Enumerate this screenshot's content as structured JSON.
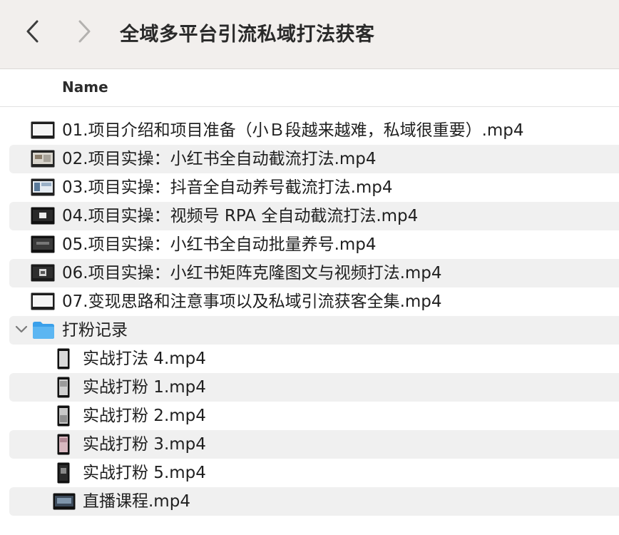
{
  "window": {
    "title": "全域多平台引流私域打法获客"
  },
  "columns": {
    "name": "Name"
  },
  "files": [
    {
      "name": "01.项目介绍和项目准备（小Ｂ段越来越难，私域很重要）.mp4",
      "icon": "video-thumbnail-icon"
    },
    {
      "name": "02.项目实操：小红书全自动截流打法.mp4",
      "icon": "video-thumbnail-icon"
    },
    {
      "name": "03.项目实操：抖音全自动养号截流打法.mp4",
      "icon": "video-thumbnail-icon"
    },
    {
      "name": "04.项目实操：视频号 RPA 全自动截流打法.mp4",
      "icon": "video-thumbnail-icon"
    },
    {
      "name": "05.项目实操：小红书全自动批量养号.mp4",
      "icon": "video-thumbnail-icon"
    },
    {
      "name": "06.项目实操：小红书矩阵克隆图文与视频打法.mp4",
      "icon": "video-thumbnail-icon"
    },
    {
      "name": "07.变现思路和注意事项以及私域引流获客全集.mp4",
      "icon": "video-thumbnail-icon"
    }
  ],
  "folder": {
    "name": "打粉记录",
    "icon": "folder-icon",
    "expanded": true,
    "children": [
      {
        "name": "实战打法 4.mp4",
        "icon": "video-thumbnail-icon"
      },
      {
        "name": "实战打粉 1.mp4",
        "icon": "video-thumbnail-icon"
      },
      {
        "name": "实战打粉 2.mp4",
        "icon": "video-thumbnail-icon"
      },
      {
        "name": "实战打粉 3.mp4",
        "icon": "video-thumbnail-icon"
      },
      {
        "name": "实战打粉 5.mp4",
        "icon": "video-thumbnail-icon"
      },
      {
        "name": "直播课程.mp4",
        "icon": "video-thumbnail-icon"
      }
    ]
  },
  "colors": {
    "toolbar_bg": "#f2efed",
    "row_alt_bg": "#f0f0f0",
    "folder_blue": "#3aa0ea"
  }
}
